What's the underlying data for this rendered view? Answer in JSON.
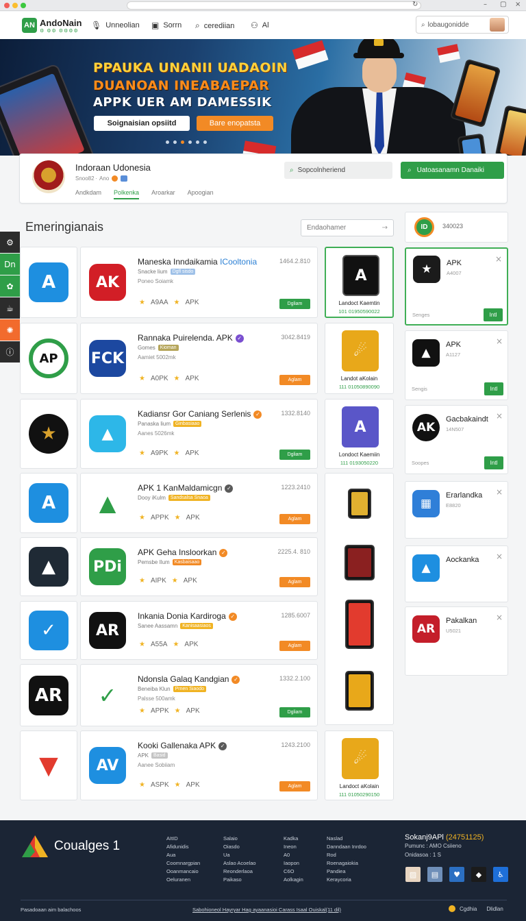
{
  "topnav": {
    "logo_name": "AndoNain",
    "logo_sub": "⚙ ⚙⚙ ⚙⚙⚙⚙",
    "links": [
      {
        "icon": "microphone-icon",
        "label": "Unneolian"
      },
      {
        "icon": "window-icon",
        "label": "Sorrn"
      },
      {
        "icon": "search-icon",
        "label": "cerediian"
      },
      {
        "icon": "people-icon",
        "label": "Al"
      }
    ],
    "search_placeholder": "lobaugonidde"
  },
  "hero": {
    "line1": "PPAUKA UNANII UADAOIN",
    "line2": "DUANOAN INEABAEPAR",
    "line3": "APPK UER AM DAMESSIK",
    "button_primary": "Soignaisian opsiitd",
    "button_secondary": "Bare enopatsta",
    "slides": 6,
    "active_slide": 2
  },
  "profile": {
    "name": "Indoraan Udonesia",
    "meta": "Snoo82 ·  Ano",
    "tabs": [
      "Andkdam",
      "Polkenka",
      "Aroarkar",
      "Apoogian"
    ],
    "active_tab": 1,
    "search_placeholder": "Sopcolnheriend",
    "action_button": "Uatoasanamn Danaiki"
  },
  "sidebar": {
    "items": [
      {
        "icon": "gear-icon",
        "color": "#2c2c2c"
      },
      {
        "icon": "dashboard-icon",
        "label": "Dn",
        "color": "#2f9e48"
      },
      {
        "icon": "settings-icon",
        "color": "#2f9e48"
      },
      {
        "icon": "cup-icon",
        "color": "#2c2c2c"
      },
      {
        "icon": "sparkle-icon",
        "color": "#f26b2d"
      },
      {
        "icon": "info-icon",
        "color": "#2c2c2c"
      }
    ]
  },
  "main": {
    "section_title": "Emeringianais",
    "sort_placeholder": "Endaohamer",
    "rows": [
      {
        "left_icon": "A",
        "left_color": "#1e8fe0",
        "icon_text": "AK",
        "icon_color": "#d21e26",
        "title": "Maneska Inndaikamia",
        "title_accent": "ICooltonia",
        "verify_color": "",
        "sub": "Snacke lium",
        "tag": "Dgfl sisdo",
        "tag_color": "#9fc1e8",
        "size": "Poneo Soiamk",
        "num": "1464.2.810",
        "rating": "A9AA",
        "label": "APK",
        "dl": "Dgliam",
        "dl_color": "#2f9e48"
      },
      {
        "left_icon": "AP",
        "left_color": "#2f9e48",
        "icon_text": "FCK",
        "icon_color": "#1c48a0",
        "title": "Rannaka Puirelenda. APK",
        "title_accent": "",
        "verify_color": "#7a4fd0",
        "sub": "Gomes",
        "tag": "Kioman",
        "tag_color": "#b5a55a",
        "size": "Aamiet 5002mk",
        "num": "3042.8419",
        "rating": "A0PK",
        "label": "APK",
        "dl": "Aglam",
        "dl_color": "#f28a25"
      },
      {
        "left_icon": "★",
        "left_color": "#111111",
        "icon_text": "▲",
        "icon_color": "#2db7e8",
        "title": "Kadiansr Gor Caniang Serlenis",
        "title_accent": "",
        "verify_color": "#f28a25",
        "sub": "Panaska lium",
        "tag": "Ginbasiaao",
        "tag_color": "#f0b323",
        "size": "Aanes 5026mk",
        "num": "1332.8140",
        "rating": "A9PK",
        "label": "APK",
        "dl": "Dgliam",
        "dl_color": "#2f9e48"
      },
      {
        "left_icon": "A",
        "left_color": "#1e8fe0",
        "icon_text": "▲",
        "icon_color": "#ffffff",
        "title": "APK 1 KanMaldamicgn",
        "title_accent": "",
        "verify_color": "#5a5a5a",
        "sub": "Dooy iKulm",
        "tag": "Sandsalsa Snaoa",
        "tag_color": "#f0b323",
        "size": "",
        "num": "1223.2410",
        "rating": "APPK",
        "label": "APK",
        "dl": "Aglam",
        "dl_color": "#f28a25"
      },
      {
        "left_icon": "▲",
        "left_color": "#1f2a35",
        "icon_text": "PDi",
        "icon_color": "#2f9e48",
        "title": "APK Geha Insloorkan",
        "title_accent": "",
        "verify_color": "#f28a25",
        "sub": "Pemsbe Ilum",
        "tag": "Kasbaisaao",
        "tag_color": "#f28a25",
        "size": "",
        "num": "2225.4. 810",
        "rating": "AIPK",
        "label": "APK",
        "dl": "Aglam",
        "dl_color": "#f28a25"
      },
      {
        "left_icon": "✓",
        "left_color": "#1e8fe0",
        "icon_text": "AR",
        "icon_color": "#111111",
        "title": "Inkania Donia Kardiroga",
        "title_accent": "",
        "verify_color": "#f28a25",
        "sub": "Sanee Aassamn",
        "tag": "Kanisaasiaos",
        "tag_color": "#f0b323",
        "size": "",
        "num": "1285.6007",
        "rating": "A55A",
        "label": "APK",
        "dl": "Aglam",
        "dl_color": "#f28a25"
      },
      {
        "left_icon": "AR",
        "left_color": "#111111",
        "icon_text": "✓",
        "icon_color": "#ffffff",
        "title": "Ndonsla Galaq Kandgian",
        "title_accent": "",
        "verify_color": "#f28a25",
        "sub": "Beneiba Klun",
        "tag": "Prnen Siaodo",
        "tag_color": "#f0b323",
        "size": "Palsse 500amk",
        "num": "1332.2.100",
        "rating": "APPK",
        "label": "APK",
        "dl": "Dgliam",
        "dl_color": "#2f9e48"
      },
      {
        "left_icon": "▼",
        "left_color": "#ffffff",
        "icon_text": "AV",
        "icon_color": "#1e8fe0",
        "title": "Kooki Gallenaka APK",
        "title_accent": "",
        "verify_color": "#5a5a5a",
        "sub": "APK",
        "tag": "Basid",
        "tag_color": "#c4c4c4",
        "size": "Aanee Sobiiam",
        "num": "1243.2100",
        "rating": "ASPK",
        "label": "APK",
        "dl": "Aglam",
        "dl_color": "#f28a25"
      }
    ],
    "featured": [
      {
        "icon": "A",
        "color": "#111111",
        "name": "Landoct Kaemtin",
        "code": "101 01950590022"
      },
      {
        "icon": "☄",
        "color": "#e8a81a",
        "name": "Landot aKolain",
        "code": "111 01050890090"
      },
      {
        "icon": "A",
        "color": "#5a56c8",
        "name": "Londoct Kaemiin",
        "code": "111 0193050220"
      },
      {
        "icon": "",
        "color": "#ffffff",
        "name": "",
        "code": ""
      },
      {
        "icon": "☄",
        "color": "#e8a81a",
        "name": "Landoct aKolain",
        "code": "111 01050290150"
      }
    ]
  },
  "right": {
    "top_label": "340023",
    "top_icon": "ID",
    "cards": [
      {
        "icon": "★",
        "color": "#1b1b1b",
        "name": "APK",
        "sub": "A4007",
        "foot": "Senges",
        "button": "Intl"
      },
      {
        "icon": "▲",
        "color": "#111111",
        "name": "APK",
        "sub": "A1127",
        "foot": "Sengis",
        "button": "Intl"
      },
      {
        "icon": "AK",
        "color": "#111111",
        "name": "Gacbakaindt",
        "sub": "14N507",
        "foot": "Soopes",
        "button": "Intl"
      },
      {
        "icon": "▦",
        "color": "#2f7fd8",
        "name": "Erarlandka",
        "sub": "E8820",
        "foot": "",
        "button": ""
      },
      {
        "icon": "▲",
        "color": "#1e8fe0",
        "name": "Aockanka",
        "sub": "",
        "foot": "",
        "button": ""
      },
      {
        "icon": "AR",
        "color": "#c41e2a",
        "name": "Pakalkan",
        "sub": "U5021",
        "foot": "",
        "button": ""
      }
    ]
  },
  "footer": {
    "brand": "Coualges 1",
    "cols": [
      [
        "AItID",
        "Afidunidis",
        "Aua",
        "Coomnargpian",
        "Ooanmancaio",
        "Oeluranen"
      ],
      [
        "Salaio",
        "Oiasdo",
        "Ua",
        "Aslao Acoelao",
        "Reonderlaoa",
        "Paikaso"
      ],
      [
        "Kadka",
        "Ineon",
        "A0",
        "Iaopon",
        "C6O",
        "Aolkagin"
      ],
      [
        "Naslad",
        "Danndaan Inrdoo",
        "Rod",
        "Roenagaiokia",
        "Pandiea",
        "Keraycoria"
      ]
    ],
    "right_title": "Sokanj9APl",
    "right_title_accent": "(24751125)",
    "right_line2": "Pumunc : AMO Csiieno",
    "right_line3": "Onidasoa : 1 S",
    "social": [
      {
        "icon": "photo-icon",
        "color": "#e8d6c2"
      },
      {
        "icon": "card-icon",
        "color": "#6f8fb8"
      },
      {
        "icon": "heart-icon",
        "color": "#2b6fc2"
      },
      {
        "icon": "kite-icon",
        "color": "#1b1b1b"
      },
      {
        "icon": "accessibility-icon",
        "color": "#1e6fd8"
      }
    ],
    "copyright": "Pasadoaan aim balachoos",
    "links": "Sabohioneol Hayryar Hag ayaanasioi Carass Isaal Ouiskal(11 dil)",
    "bottom_right_1": "Cgdhia",
    "bottom_right_2": "Dlidlan"
  }
}
